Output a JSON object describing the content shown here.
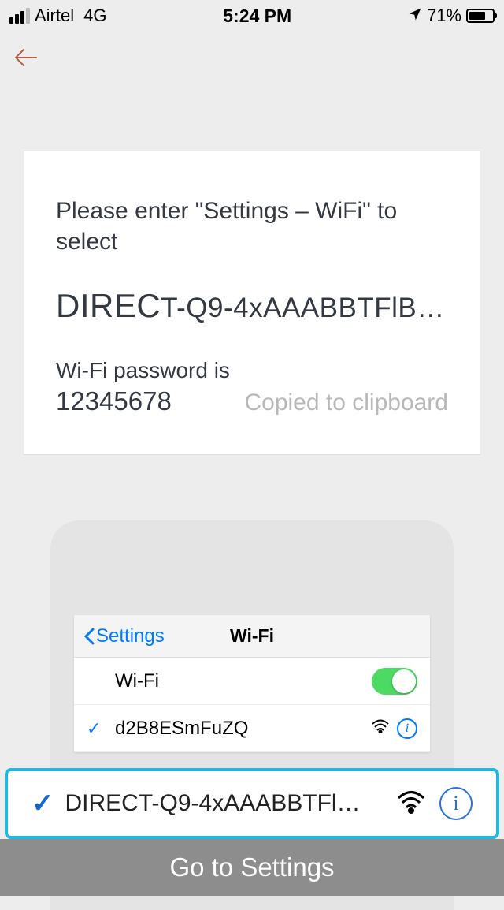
{
  "status": {
    "carrier": "Airtel",
    "network_type": "4G",
    "time": "5:24 PM",
    "battery_pct": "71%"
  },
  "card": {
    "instruction": "Please enter \"Settings – WiFi\" to select",
    "ssid_first": "DIREC",
    "ssid_rest": "T-Q9-4xAAABBTFlB…",
    "pw_label": "Wi-Fi password is",
    "password": "12345678",
    "copied": "Copied to clipboard"
  },
  "preview": {
    "back_label": "Settings",
    "title": "Wi-Fi",
    "wifi_label": "Wi-Fi",
    "connected_ssid": "d2B8ESmFuZQ"
  },
  "highlight": {
    "ssid": "DIRECT-Q9-4xAAABBTFl…"
  },
  "footer": {
    "button": "Go to Settings"
  }
}
